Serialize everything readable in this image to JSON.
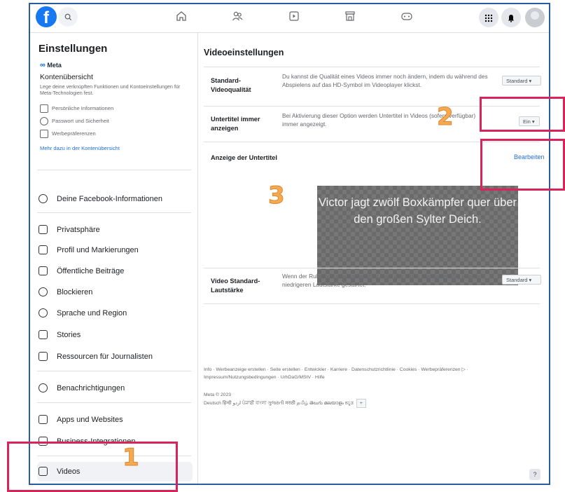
{
  "topbar": {
    "logo_letter": "f",
    "search_icon": "search-icon",
    "nav_icons": [
      "home-icon",
      "friends-icon",
      "watch-icon",
      "marketplace-icon",
      "gaming-icon"
    ],
    "right_icons": [
      "menu-grid-icon",
      "notification-bell-icon",
      "avatar"
    ]
  },
  "sidebar": {
    "title": "Einstellungen",
    "meta_brand": "Meta",
    "accounts_center": {
      "title": "Kontenübersicht",
      "description": "Lege deine verknüpften Funktionen und Kontoeinstellungen für Meta-Technologien fest.",
      "items": [
        "Persönliche Informationen",
        "Passwort und Sicherheit",
        "Werbepräferenzen"
      ],
      "link": "Mehr dazu in der Kontenübersicht"
    },
    "items": [
      {
        "label": "Deine Facebook-Informationen"
      },
      {
        "label": "Privatsphäre"
      },
      {
        "label": "Profil und Markierungen"
      },
      {
        "label": "Öffentliche Beiträge"
      },
      {
        "label": "Blockieren"
      },
      {
        "label": "Sprache und Region"
      },
      {
        "label": "Stories"
      },
      {
        "label": "Ressourcen für Journalisten"
      },
      {
        "label": "Benachrichtigungen"
      },
      {
        "label": "Apps und Websites"
      },
      {
        "label": "Business-Integrationen"
      },
      {
        "label": "Videos"
      }
    ]
  },
  "main": {
    "title": "Videoeinstellungen",
    "rows": [
      {
        "label": "Standard-Videoqualität",
        "description": "Du kannst die Qualität eines Videos immer noch ändern, indem du während des Abspielens auf das HD-Symbol im Videoplayer klickst.",
        "control": "Standard ▾"
      },
      {
        "label": "Untertitel immer anzeigen",
        "description": "Bei Aktivierung dieser Option werden Untertitel in Videos (sofern verfügbar) immer angezeigt.",
        "control": "Ein ▾"
      },
      {
        "label": "Anzeige der Untertitel",
        "description": "",
        "control": "Bearbeiten"
      },
      {
        "label": "Video Standard-Lautstärke",
        "description": "Wenn der Ruhemodus ausgewählt ist, wird das Video standardmäßig in einer niedrigeren Lautstärke gestartet.",
        "control": "Standard ▾"
      }
    ],
    "caption_preview": "Victor jagt zwölf Boxkämpfer quer über den großen Sylter Deich."
  },
  "footer": {
    "links": "Info · Werbeanzeige erstellen · Seite erstellen · Entwickler · Karriere · Datenschutzrichtlinie · Cookies · Werbepräferenzen ▷ · Impressum/Nutzungsbedingungen · UrhDaG/MStV · Hilfe",
    "copyright": "Meta © 2023",
    "languages": "Deutsch  हिन्दी  اردو  ਪੰਜਾਬੀ  বাংলা  ગુજરાતી  मराठी  தமிழ்  తెలుగు  മലയാളം  ಕನ್ನಡ"
  },
  "annotations": [
    "1",
    "2",
    "3"
  ],
  "colors": {
    "annotation_box": "#d8245a",
    "annotation_number": "#f4aa50",
    "accent": "#1877f2",
    "frame": "#2a5d9f"
  }
}
